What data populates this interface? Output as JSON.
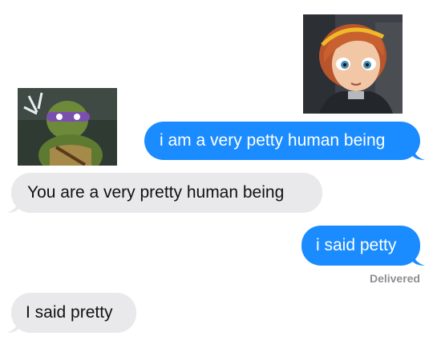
{
  "conversation": {
    "messages": [
      {
        "direction": "sent",
        "text": "i am a very petty human being"
      },
      {
        "direction": "received",
        "text": "You are a very pretty human being"
      },
      {
        "direction": "sent",
        "text": "i said petty"
      },
      {
        "direction": "received",
        "text": "I said pretty"
      }
    ],
    "status": "Delivered"
  },
  "colors": {
    "sent_bubble": "#1a8cff",
    "received_bubble": "#e9e9eb",
    "status_text": "#8e8e93"
  },
  "avatars": [
    {
      "icon": "redhead-girl-avatar"
    },
    {
      "icon": "purple-masked-turtle-avatar"
    }
  ]
}
